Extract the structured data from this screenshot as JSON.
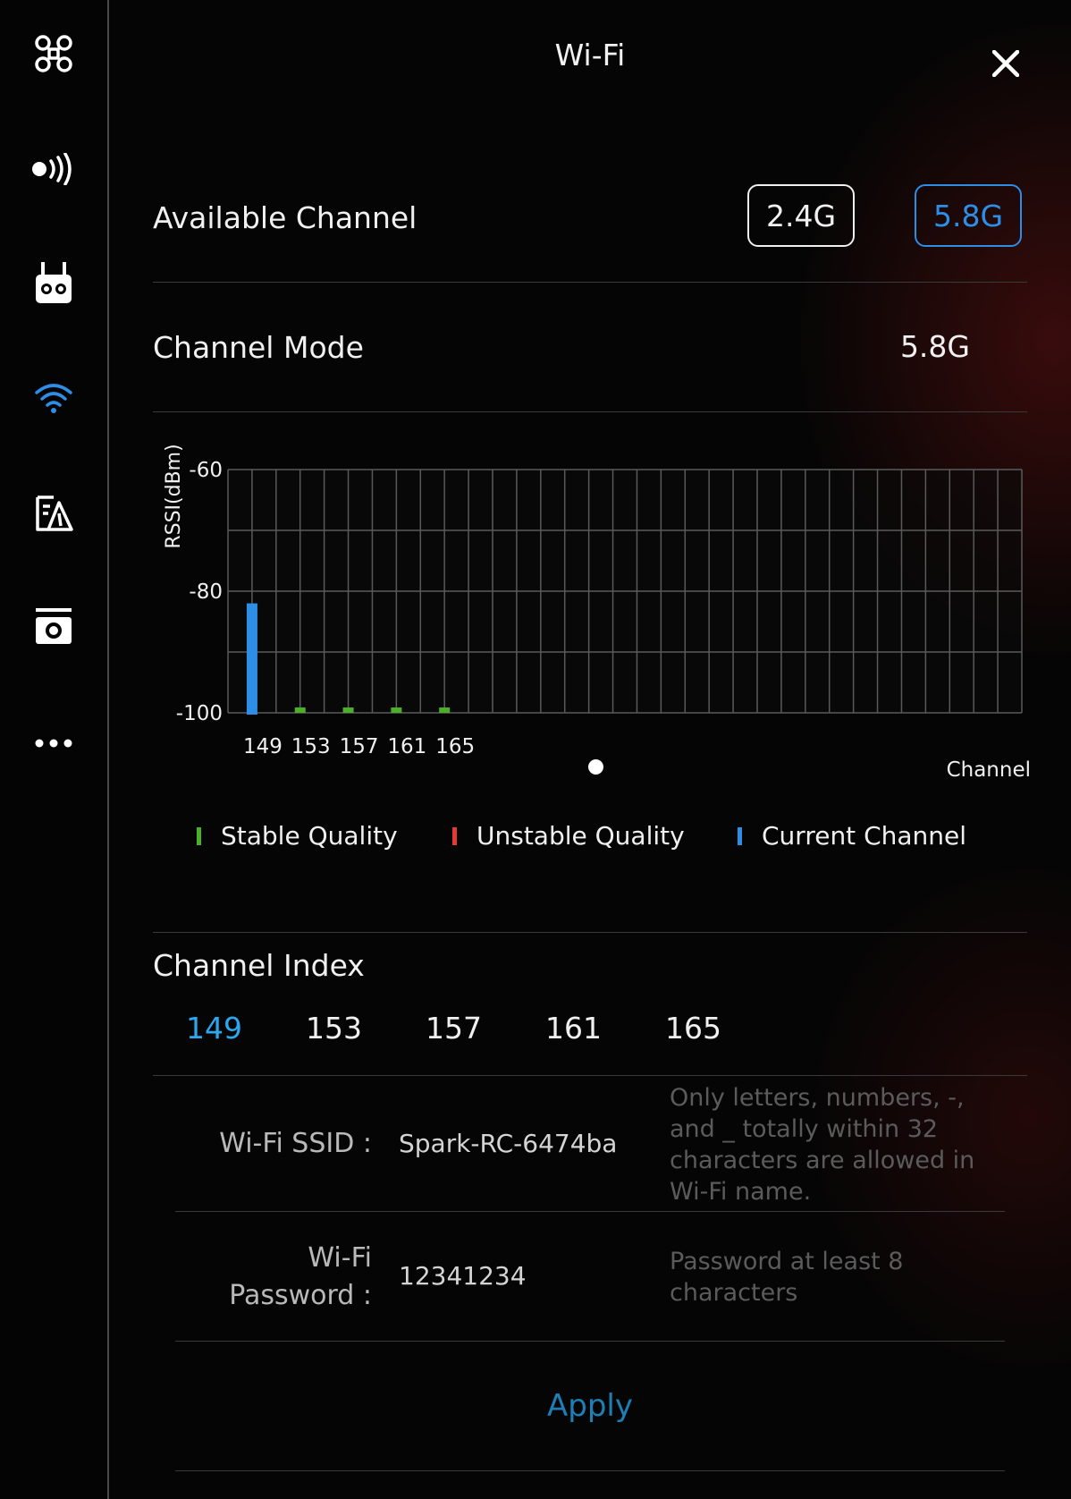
{
  "header": {
    "title": "Wi-Fi"
  },
  "sidebar": {
    "items": [
      {
        "icon": "drone-icon"
      },
      {
        "icon": "signal-broadcast-icon"
      },
      {
        "icon": "remote-controller-icon"
      },
      {
        "icon": "wifi-icon",
        "active": true
      },
      {
        "icon": "flight-settings-icon"
      },
      {
        "icon": "camera-icon"
      },
      {
        "icon": "more-icon"
      }
    ]
  },
  "available_channel": {
    "label": "Available Channel",
    "options": [
      "2.4G",
      "5.8G"
    ],
    "selected": "5.8G"
  },
  "channel_mode": {
    "label": "Channel Mode",
    "value": "5.8G"
  },
  "chart_data": {
    "type": "bar",
    "ylabel": "RSSI(dBm)",
    "xlabel": "Channel",
    "ylim": [
      -100,
      -60
    ],
    "yticks": [
      "-60",
      "-80",
      "-100"
    ],
    "categories": [
      "149",
      "153",
      "157",
      "161",
      "165"
    ],
    "values": [
      -82,
      -100,
      -100,
      -100,
      -100
    ],
    "status": [
      "current",
      "stable",
      "stable",
      "stable",
      "stable"
    ],
    "grid": true,
    "colors": {
      "stable": "#4caf2a",
      "unstable": "#e53935",
      "current": "#2e8ee6"
    }
  },
  "legend": {
    "stable": "Stable Quality",
    "unstable": "Unstable Quality",
    "current": "Current Channel"
  },
  "channel_index": {
    "label": "Channel Index",
    "items": [
      "149",
      "153",
      "157",
      "161",
      "165"
    ],
    "selected": "149"
  },
  "ssid": {
    "label": "Wi-Fi SSID :",
    "value": "Spark-RC-6474ba",
    "hint": "Only letters, numbers, -, and _ totally within 32 characters are allowed in Wi-Fi name."
  },
  "password": {
    "label_line1": "Wi-Fi",
    "label_line2": "Password :",
    "value": "12341234",
    "hint": "Password at least 8 characters"
  },
  "apply_label": "Apply",
  "colors": {
    "accent": "#2e8ee6",
    "apply": "#1c7fb6",
    "selected_index": "#2aa8f0"
  }
}
